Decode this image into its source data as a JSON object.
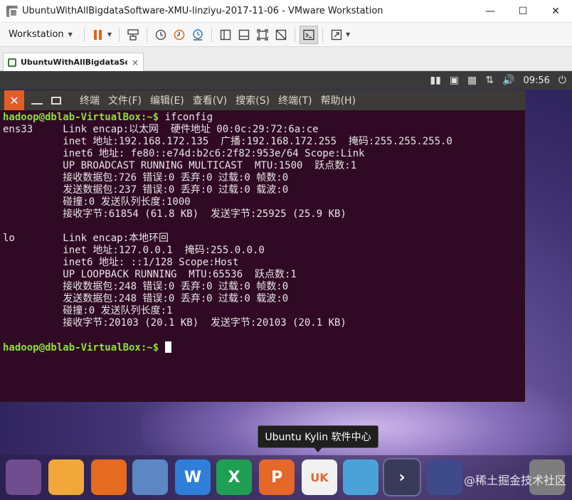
{
  "window": {
    "title": "UbuntuWithAllBigdataSoftware-XMU-linziyu-2017-11-06 - VMware Workstation",
    "minimize": "—",
    "maximize": "☐",
    "close": "✕"
  },
  "toolbar": {
    "menu_label": "Workstation",
    "caret": "▼"
  },
  "tab": {
    "label": "UbuntuWithAllBigdataSoft...",
    "close": "×"
  },
  "guest_panel": {
    "clock": "09:56"
  },
  "terminal": {
    "menu": [
      "终端",
      "文件(F)",
      "编辑(E)",
      "查看(V)",
      "搜索(S)",
      "终端(T)",
      "帮助(H)"
    ],
    "prompt": "hadoop@dblab-VirtualBox:~$",
    "command": " ifconfig",
    "output": [
      "ens33     Link encap:以太网  硬件地址 00:0c:29:72:6a:ce",
      "          inet 地址:192.168.172.135  广播:192.168.172.255  掩码:255.255.255.0",
      "          inet6 地址: fe80::e74d:b2c6:2f82:953e/64 Scope:Link",
      "          UP BROADCAST RUNNING MULTICAST  MTU:1500  跃点数:1",
      "          接收数据包:726 错误:0 丢弃:0 过载:0 帧数:0",
      "          发送数据包:237 错误:0 丢弃:0 过载:0 载波:0",
      "          碰撞:0 发送队列长度:1000",
      "          接收字节:61854 (61.8 KB)  发送字节:25925 (25.9 KB)",
      "",
      "lo        Link encap:本地环回",
      "          inet 地址:127.0.0.1  掩码:255.0.0.0",
      "          inet6 地址: ::1/128 Scope:Host",
      "          UP LOOPBACK RUNNING  MTU:65536  跃点数:1",
      "          接收数据包:248 错误:0 丢弃:0 过载:0 帧数:0",
      "          发送数据包:248 错误:0 丢弃:0 过载:0 载波:0",
      "          碰撞:0 发送队列长度:1",
      "          接收字节:20103 (20.1 KB)  发送字节:20103 (20.1 KB)",
      ""
    ],
    "prompt2": "hadoop@dblab-VirtualBox:~$",
    "colors": {
      "background": "#300a24",
      "prompt": "#8ae234",
      "text": "#e6e6e6"
    }
  },
  "tooltip": {
    "text": "Ubuntu Kylin 软件中心"
  },
  "dock": {
    "items": [
      {
        "icon": "ubuntu-dash-icon",
        "color": "#6f4d8f"
      },
      {
        "icon": "files-folder-icon",
        "color": "#f2a73b"
      },
      {
        "icon": "firefox-icon",
        "color": "#e66a1f"
      },
      {
        "icon": "chromium-icon",
        "color": "#5d86c4"
      },
      {
        "icon": "wps-writer-icon",
        "color": "#2f7fd9",
        "label": "W"
      },
      {
        "icon": "wps-spreadsheet-icon",
        "color": "#1f9f52",
        "label": "X"
      },
      {
        "icon": "wps-presentation-icon",
        "color": "#e5672a",
        "label": "P"
      },
      {
        "icon": "kylin-software-center-icon",
        "color": "#f1f1f1",
        "label": "UK"
      },
      {
        "icon": "update-manager-icon",
        "color": "#4aa3d8"
      },
      {
        "icon": "terminal-app-icon",
        "color": "#3a3a5a",
        "label": "›"
      },
      {
        "icon": "workspace-switcher-icon",
        "color": "#3f4a8a"
      },
      {
        "icon": "trash-icon",
        "color": "#7c7c7c"
      }
    ],
    "watermark": "@稀土掘金技术社区"
  }
}
